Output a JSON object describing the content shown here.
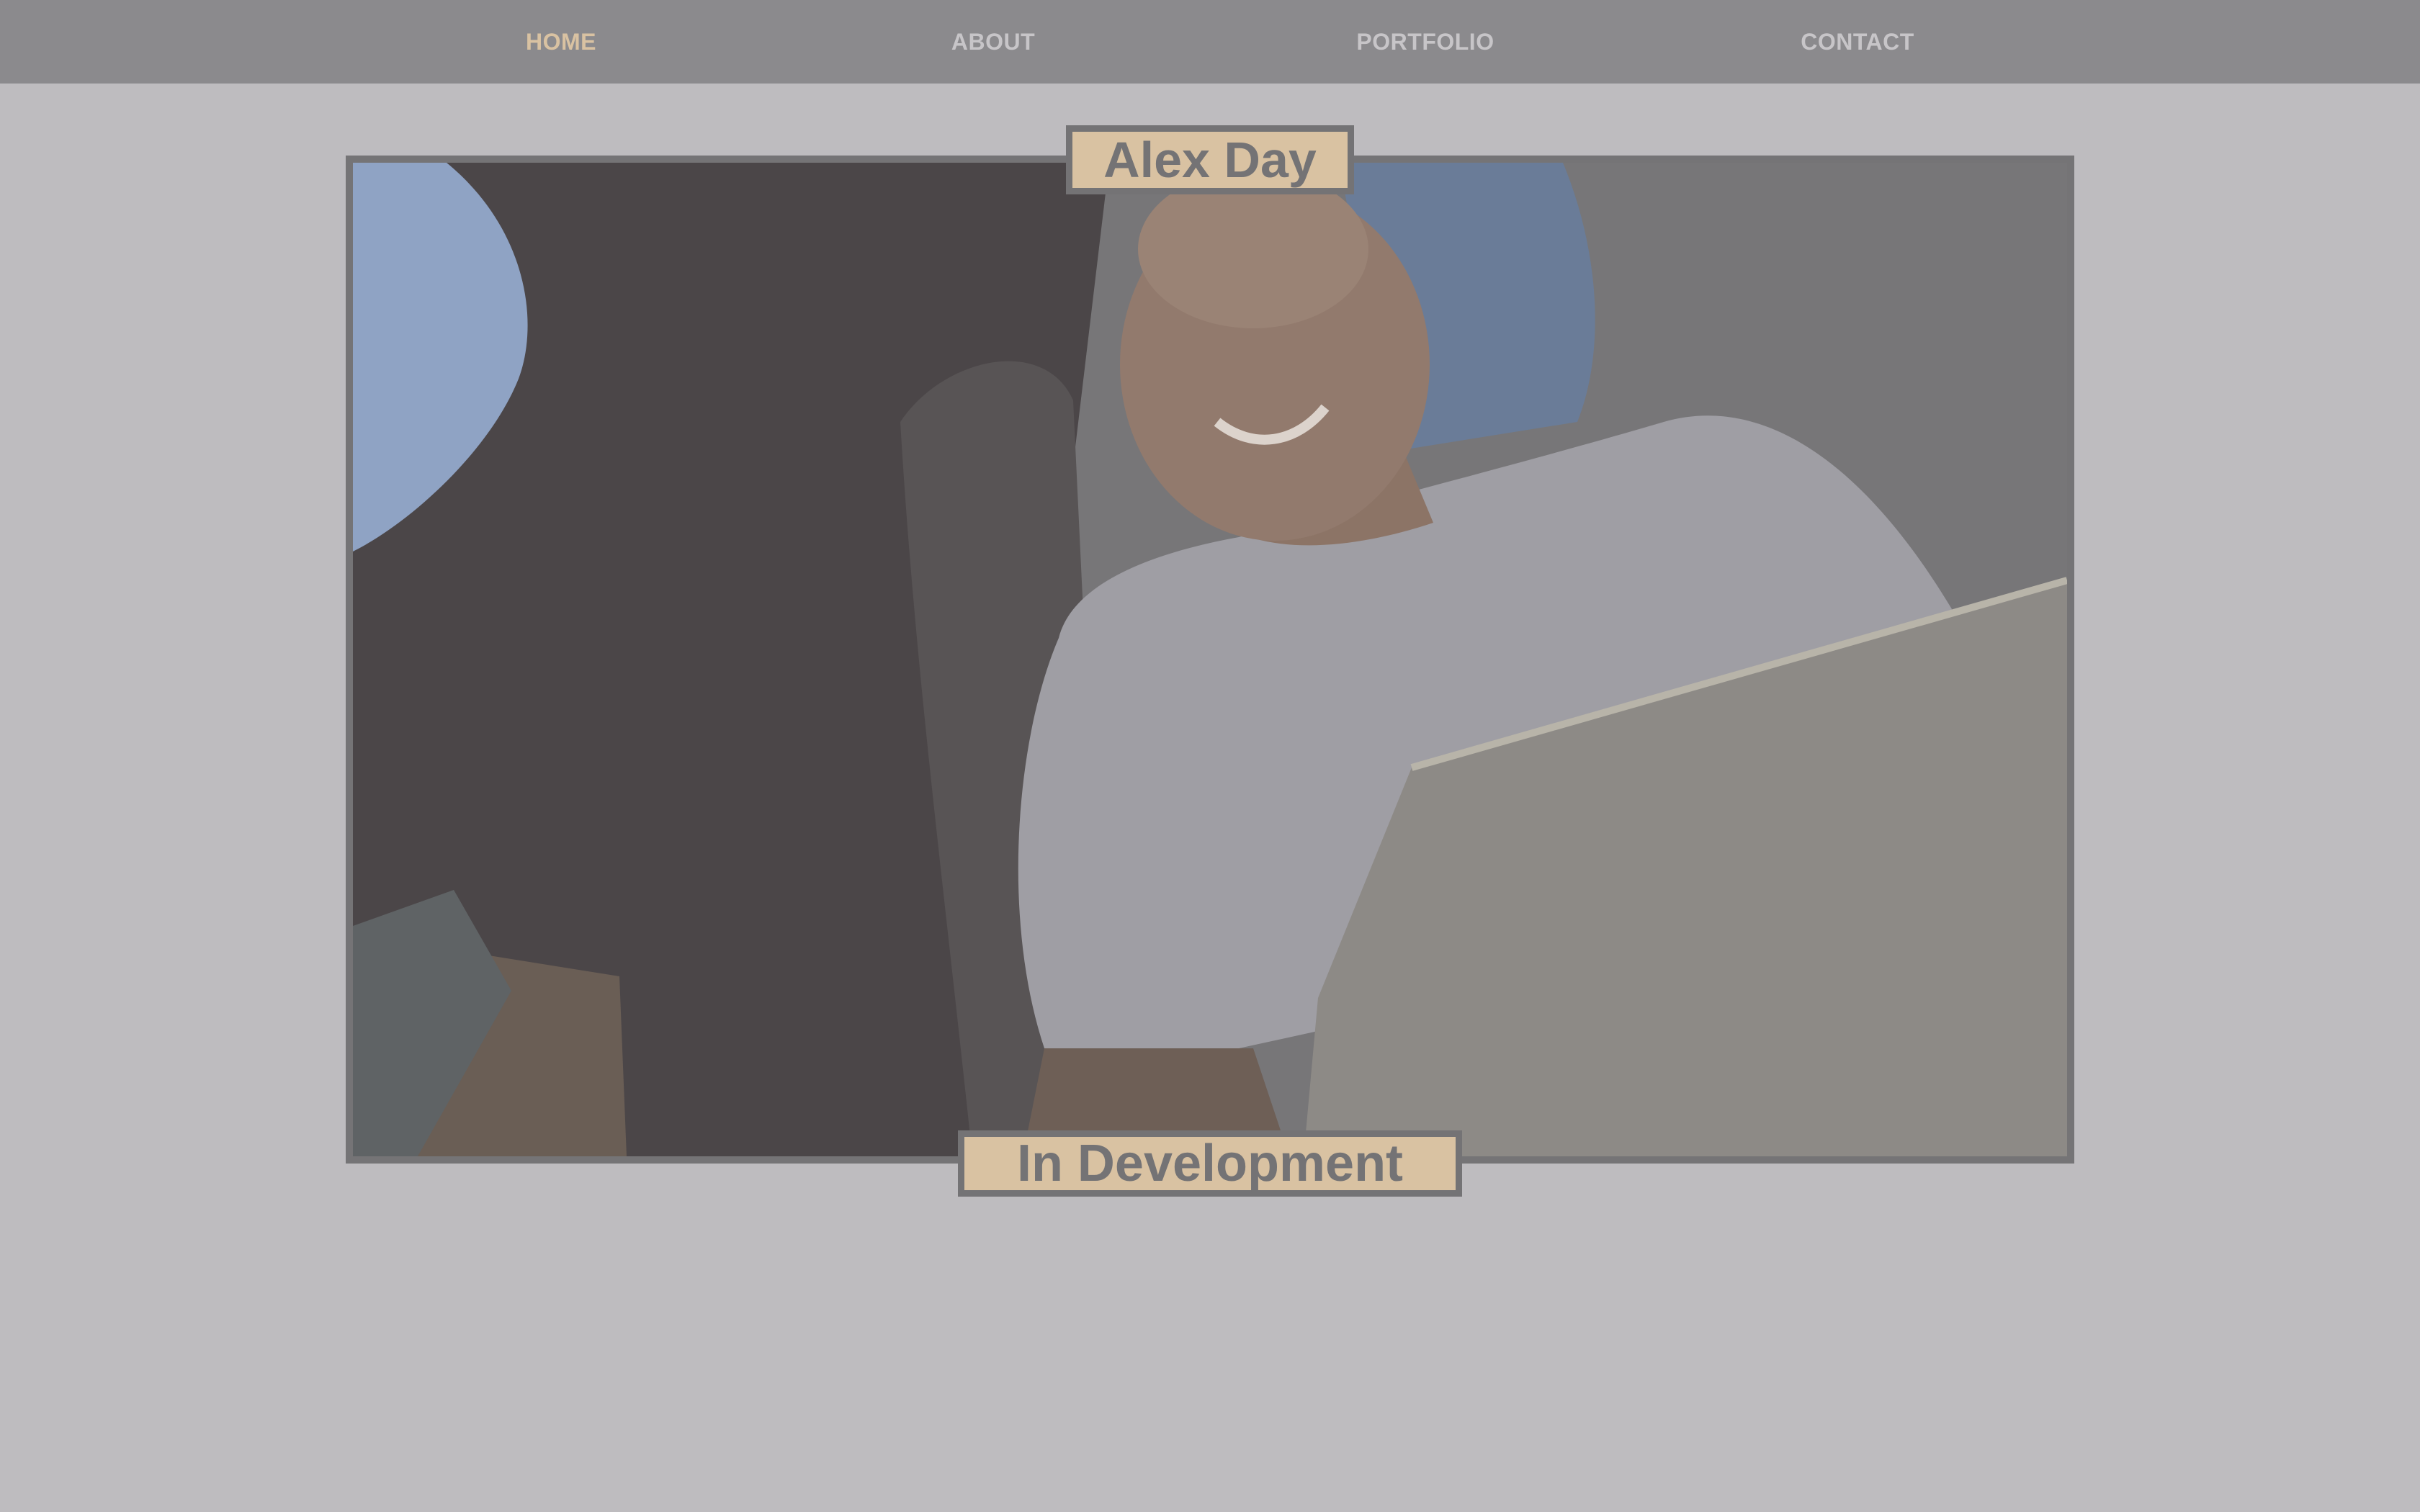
{
  "nav": {
    "items": [
      {
        "label": "HOME",
        "active": true
      },
      {
        "label": "ABOUT",
        "active": false
      },
      {
        "label": "PORTFOLIO",
        "active": false
      },
      {
        "label": "CONTACT",
        "active": false
      }
    ]
  },
  "hero": {
    "name": "Alex Day",
    "status": "In Development"
  },
  "colors": {
    "page_background": "#bebcbf",
    "nav_background": "#8b8a8d",
    "nav_text": "#c7c5c8",
    "nav_active": "#d9c2a2",
    "tag_background": "#d9c2a2",
    "tag_text": "#747375"
  }
}
